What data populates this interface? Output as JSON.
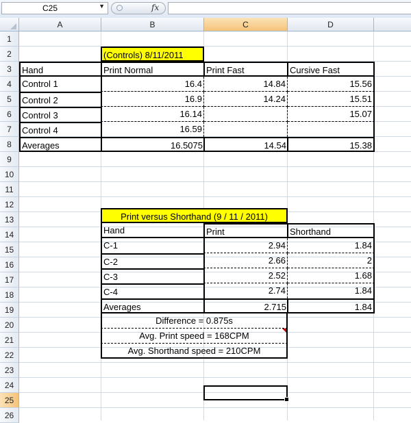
{
  "formula_bar": {
    "name_box": "C25",
    "fx_label": "fx",
    "formula": ""
  },
  "columns": [
    "A",
    "B",
    "C",
    "D"
  ],
  "selected_column": "C",
  "rows": [
    "1",
    "2",
    "3",
    "4",
    "5",
    "6",
    "7",
    "8",
    "9",
    "10",
    "11",
    "12",
    "13",
    "14",
    "15",
    "16",
    "17",
    "18",
    "19",
    "20",
    "21",
    "22",
    "23",
    "24",
    "25",
    "26"
  ],
  "selected_row": "25",
  "table1": {
    "title": "(Controls) 8/11/2011",
    "headers": [
      "Hand",
      "Print Normal",
      "Print Fast",
      "Cursive Fast"
    ],
    "rows": [
      [
        "Control 1",
        "16.4",
        "14.84",
        "15.56"
      ],
      [
        "Control 2",
        "16.9",
        "14.24",
        "15.51"
      ],
      [
        "Control 3",
        "16.14",
        "",
        "15.07"
      ],
      [
        "Control 4",
        "16.59",
        "",
        ""
      ],
      [
        "Averages",
        "16.5075",
        "14.54",
        "15.38"
      ]
    ]
  },
  "table2": {
    "title": "Print versus Shorthand (9 / 11 / 2011)",
    "headers": [
      "Hand",
      "Print",
      "Shorthand"
    ],
    "rows": [
      [
        "C-1",
        "2.94",
        "1.84"
      ],
      [
        "C-2",
        "2.66",
        "2"
      ],
      [
        "C-3",
        "2.52",
        "1.68"
      ],
      [
        "C-4",
        "2.74",
        "1.84"
      ],
      [
        "Averages",
        "2.715",
        "1.84"
      ]
    ],
    "notes": [
      "Difference = 0.875s",
      "Avg. Print speed = 168CPM",
      "Avg. Shorthand speed = 210CPM"
    ]
  }
}
